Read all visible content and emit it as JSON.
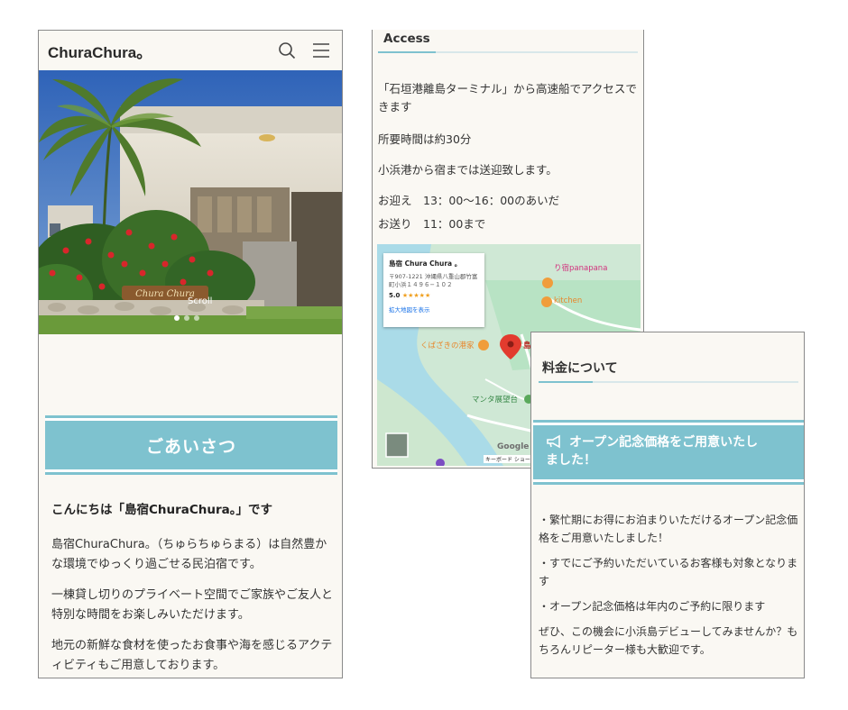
{
  "panel1": {
    "brand": "ChuraChura。",
    "icons": {
      "search": "search-icon",
      "menu": "hamburger-menu-icon"
    },
    "hero": {
      "sign_text": "Chura Chura",
      "scroll_label": "Scroll",
      "slide_count": 3,
      "active_slide": 1
    },
    "greeting_heading": "ごあいさつ",
    "intro_title": "こんにちは「島宿ChuraChura。」です",
    "paragraphs": [
      "島宿ChuraChura。（ちゅらちゅらまる）は自然豊かな環境でゆっくり過ごせる民泊宿です。",
      "一棟貸し切りのプライベート空間でご家族やご友人と特別な時間をお楽しみいただけます。",
      "地元の新鮮な食材を使ったお食事や海を感じるアクティビティもご用意しております。"
    ]
  },
  "panel2": {
    "section_title": "Access",
    "lines": [
      "「石垣港離島ターミナル」から高速船でアクセスできます",
      "所要時間は約30分",
      "小浜港から宿までは送迎致します。",
      "お迎え　13：00〜16：00のあいだ",
      "お送り　11：00まで"
    ],
    "map": {
      "place_name": "島宿 Chura Chura 。",
      "address": "〒907-1221 沖縄県八重山郡竹富町小浜１４９６−１０２",
      "rating": "5.0",
      "stars": "★★★★★",
      "link": "拡大地図を表示",
      "labels": {
        "panapana": "り宿panapana",
        "kitchen": "kitchen",
        "port": "くばざきの港家",
        "pin": "島宿",
        "viewpoint": "マンタ展望台",
        "google": "Google",
        "shortcuts": "キーボード ショート"
      }
    }
  },
  "panel3": {
    "section_title": "料金について",
    "promo_icon": "megaphone-icon",
    "promo_line1": "オープン記念価格をご用意いたし",
    "promo_line2": "ました！",
    "paragraphs": [
      "・繁忙期にお得にお泊まりいただけるオープン記念価格をご用意いたしました！",
      "・すでにご予約いただいているお客様も対象となります",
      "・オープン記念価格は年内のご予約に限ります",
      "ぜひ、この機会に小浜島デビューしてみませんか？もちろんリピーター様も大歓迎です。"
    ]
  },
  "colors": {
    "accent": "#7ec2cf",
    "background": "#faf8f3",
    "text": "#333333"
  }
}
